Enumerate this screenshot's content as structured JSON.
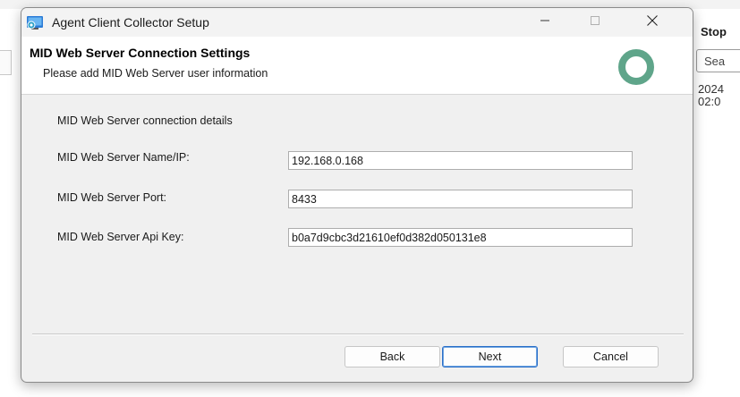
{
  "background_window": {
    "column_header": "Stop",
    "search_placeholder": "Sea",
    "date_line_1": "2024",
    "date_line_2": "02:0"
  },
  "dialog": {
    "title": "Agent Client Collector Setup",
    "header": {
      "title": "MID Web Server Connection Settings",
      "subtitle": "Please add MID Web Server user information"
    },
    "section_label": "MID Web Server connection details",
    "fields": [
      {
        "label": "MID Web Server Name/IP:",
        "value": "192.168.0.168"
      },
      {
        "label": "MID Web Server Port:",
        "value": "8433"
      },
      {
        "label": "MID Web Server Api Key:",
        "value": "b0a7d9cbc3d21610ef0d382d050131e8"
      }
    ],
    "buttons": {
      "back": "Back",
      "next": "Next",
      "cancel": "Cancel"
    }
  },
  "colors": {
    "dialog_background": "#f0f0f0",
    "header_background": "#ffffff",
    "logo_ring": "#5fa58a",
    "focus_border": "#2a6fc9"
  },
  "icons": {
    "app": "installer-app-icon",
    "minimize": "minimize-icon",
    "maximize": "maximize-icon",
    "close": "close-icon",
    "logo": "servicenow-logo-icon"
  }
}
